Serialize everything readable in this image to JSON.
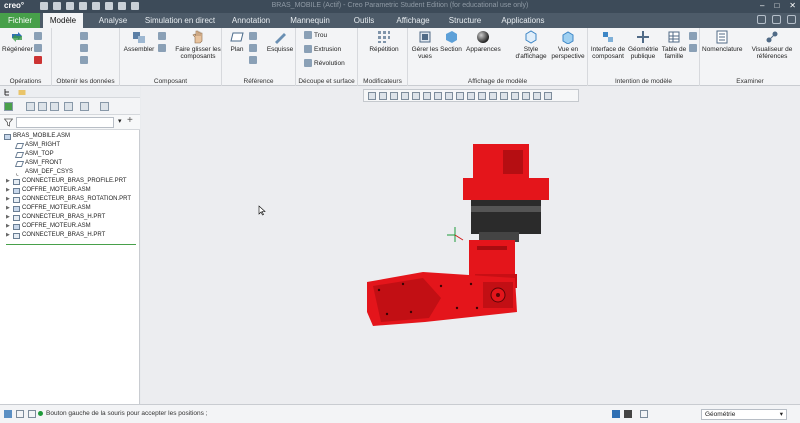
{
  "app": {
    "logo": "creo°",
    "window_title": "BRAS_MOBILE (Actif) - Creo Parametric Student Edition (for educational use only)",
    "window_controls": [
      "–",
      "□",
      "✕"
    ]
  },
  "tabs": [
    {
      "label": "Fichier"
    },
    {
      "label": "Modèle"
    },
    {
      "label": "Analyse"
    },
    {
      "label": "Simulation en direct"
    },
    {
      "label": "Annotation"
    },
    {
      "label": "Mannequin"
    },
    {
      "label": "Outils"
    },
    {
      "label": "Affichage"
    },
    {
      "label": "Structure"
    },
    {
      "label": "Applications"
    }
  ],
  "ribbon": {
    "operations": {
      "label": "Opérations",
      "regenerate": "Régénérer"
    },
    "get_data": {
      "label": "Obtenir les données"
    },
    "component": {
      "label": "Composant",
      "assemble": "Assembler",
      "drag": "Faire glisser les composants"
    },
    "reference": {
      "label": "Référence",
      "plane": "Plan",
      "sketch": "Esquisse"
    },
    "cut_surface": {
      "label": "Découpe et surface",
      "hole": "Trou",
      "extrude": "Extrusion",
      "revolve": "Révolution"
    },
    "modifiers": {
      "label": "Modificateurs",
      "pattern": "Répétition"
    },
    "model_display": {
      "label": "Affichage de modèle",
      "manage_views": "Gérer les vues",
      "section": "Section",
      "appearances": "Apparences",
      "display_style": "Style d'affichage",
      "perspective": "Vue en perspective"
    },
    "model_intent": {
      "label": "Intention de modèle",
      "component_interface": "Interface de composant",
      "publish_geom": "Géométrie publique",
      "family_table": "Table de famille"
    },
    "investigate": {
      "label": "Examiner",
      "nomenclature": "Nomenclature",
      "ref_viewer": "Visualiseur de références"
    }
  },
  "tree": {
    "root": "BRAS_MOBILE.ASM",
    "items": [
      {
        "label": "ASM_RIGHT",
        "type": "datum",
        "expand": ""
      },
      {
        "label": "ASM_TOP",
        "type": "datum",
        "expand": ""
      },
      {
        "label": "ASM_FRONT",
        "type": "datum",
        "expand": ""
      },
      {
        "label": "ASM_DEF_CSYS",
        "type": "csys",
        "expand": ""
      },
      {
        "label": "CONNECTEUR_BRAS_PROFILE.PRT",
        "type": "part",
        "expand": "▶"
      },
      {
        "label": "COFFRE_MOTEUR.ASM",
        "type": "asm",
        "expand": "▶"
      },
      {
        "label": "CONNECTEUR_BRAS_ROTATION.PRT",
        "type": "part",
        "expand": "▶"
      },
      {
        "label": "COFFRE_MOTEUR.ASM",
        "type": "asm",
        "expand": "▶"
      },
      {
        "label": "CONNECTEUR_BRAS_H.PRT",
        "type": "part",
        "expand": "▶"
      },
      {
        "label": "COFFRE_MOTEUR.ASM",
        "type": "asm",
        "expand": "▶"
      },
      {
        "label": "CONNECTEUR_BRAS_H.PRT",
        "type": "part",
        "expand": "▶"
      }
    ]
  },
  "status": {
    "message": "Bouton gauche de la souris pour accepter les positions ;",
    "selection_filter": "Géométrie"
  },
  "colors": {
    "accent": "#47a04a",
    "model": "#e4151b",
    "titlebar": "#3d4b59",
    "tabbar": "#4d5b69"
  }
}
